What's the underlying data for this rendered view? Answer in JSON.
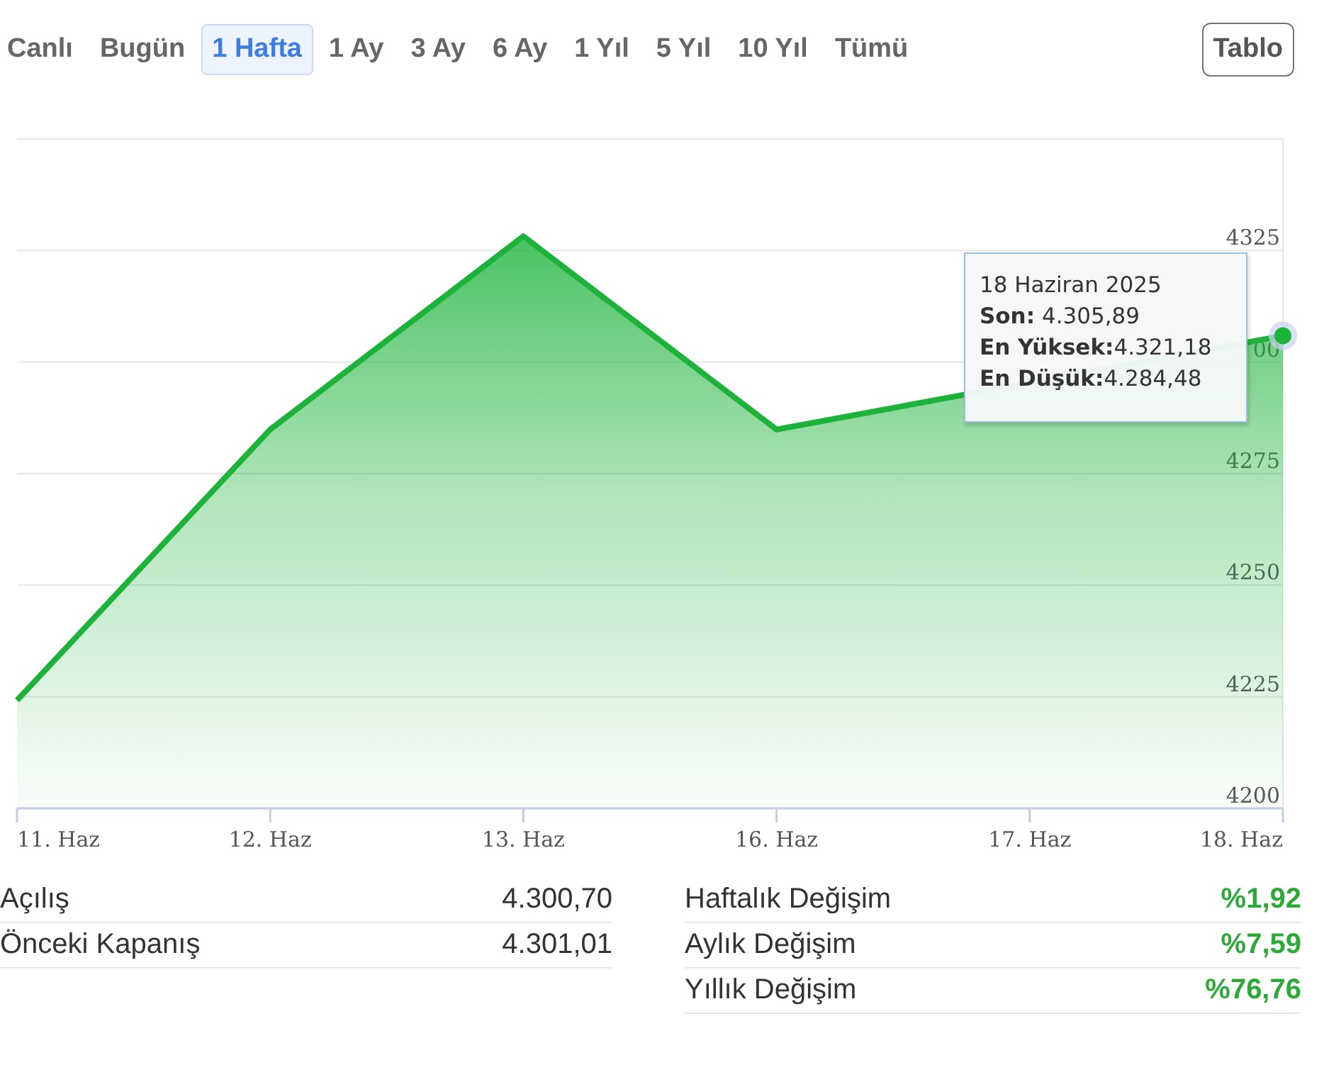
{
  "periods": [
    {
      "label": "Canlı",
      "selected": false
    },
    {
      "label": "Bugün",
      "selected": false
    },
    {
      "label": "1 Hafta",
      "selected": true
    },
    {
      "label": "1 Ay",
      "selected": false
    },
    {
      "label": "3 Ay",
      "selected": false
    },
    {
      "label": "6 Ay",
      "selected": false
    },
    {
      "label": "1 Yıl",
      "selected": false
    },
    {
      "label": "5 Yıl",
      "selected": false
    },
    {
      "label": "10 Yıl",
      "selected": false
    },
    {
      "label": "Tümü",
      "selected": false
    }
  ],
  "table_button": "Tablo",
  "chart": {
    "chart_data": {
      "type": "area",
      "categories": [
        "11. Haz",
        "12. Haz",
        "13. Haz",
        "16. Haz",
        "17. Haz",
        "18. Haz"
      ],
      "series": [
        {
          "color": "#1db33a",
          "values": [
            4224.2,
            4284.9,
            4328.2,
            4284.9,
            null,
            4305.9
          ]
        }
      ],
      "ylim": [
        4200,
        4350
      ],
      "yticks": [
        4200,
        4225,
        4250,
        4275,
        4325
      ],
      "grid": true
    },
    "covered_y_label": "00",
    "tooltip": {
      "title": "18 Haziran 2025",
      "lines": [
        "**Son:** 4.305,89",
        "**En Yüksek:**4.321,18",
        "**En Düşük:**4.284,48"
      ]
    }
  },
  "stats_left": [
    {
      "label": "Açılış",
      "value": "4.300,70"
    },
    {
      "label": "Önceki Kapanış",
      "value": "4.301,01"
    }
  ],
  "stats_right": [
    {
      "label": "Haftalık Değişim",
      "value": "%1,92"
    },
    {
      "label": "Aylık Değişim",
      "value": "%7,59"
    },
    {
      "label": "Yıllık Değişim",
      "value": "%76,76"
    }
  ]
}
